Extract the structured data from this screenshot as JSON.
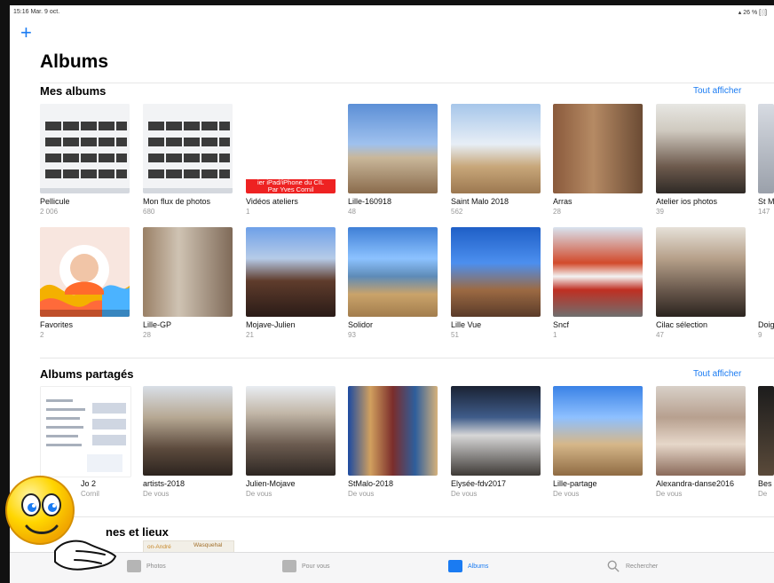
{
  "status_bar": {
    "time": "15:16 Mar. 9 oct.",
    "battery": "▴ 26 % [░]"
  },
  "header": {
    "add_icon": "plus-icon",
    "title": "Albums"
  },
  "sections": {
    "mes_albums": {
      "title": "Mes albums",
      "see_all": "Tout afficher",
      "albums": [
        {
          "name": "Pellicule",
          "count": "2 006"
        },
        {
          "name": "Mon flux de photos",
          "count": "680"
        },
        {
          "name": "Vidéos ateliers",
          "count": "1",
          "overlay_line1": "ier iPad/iPhone du CIL",
          "overlay_line2": "Par Yves Cornil"
        },
        {
          "name": "Lille-160918",
          "count": "48"
        },
        {
          "name": "Saint Malo 2018",
          "count": "562"
        },
        {
          "name": "Arras",
          "count": "28"
        },
        {
          "name": "Atelier ios photos",
          "count": "39"
        },
        {
          "name": "St M",
          "count": "147"
        },
        {
          "name": "Favorites",
          "count": "2"
        },
        {
          "name": "Lille-GP",
          "count": "28"
        },
        {
          "name": "Mojave-Julien",
          "count": "21"
        },
        {
          "name": "Solidor",
          "count": "93"
        },
        {
          "name": "Lille Vue",
          "count": "51"
        },
        {
          "name": "Sncf",
          "count": "1"
        },
        {
          "name": "Cilac sélection",
          "count": "47"
        },
        {
          "name": "Doig",
          "count": "9"
        }
      ]
    },
    "albums_partages": {
      "title": "Albums partagés",
      "see_all": "Tout afficher",
      "albums": [
        {
          "name": "Jo 2",
          "subtitle": "Cornil"
        },
        {
          "name": "artists-2018",
          "subtitle": "De vous"
        },
        {
          "name": "Julien-Mojave",
          "subtitle": "De vous"
        },
        {
          "name": "StMalo-2018",
          "subtitle": "De vous"
        },
        {
          "name": "Elysée-fdv2017",
          "subtitle": "De vous"
        },
        {
          "name": "Lille-partage",
          "subtitle": "De vous"
        },
        {
          "name": "Alexandra-danse2016",
          "subtitle": "De vous"
        },
        {
          "name": "Bes",
          "subtitle": "De"
        }
      ]
    },
    "personnes_lieux": {
      "title": "nes et lieux",
      "place_label": "Wasquehal",
      "place_label_2": "on-André"
    }
  },
  "tabbar": {
    "tabs": [
      {
        "label": "Photos",
        "icon": "photos-icon"
      },
      {
        "label": "Pour vous",
        "icon": "for-you-icon"
      },
      {
        "label": "Albums",
        "icon": "albums-icon"
      },
      {
        "label": "Rechercher",
        "icon": "search-icon"
      }
    ]
  },
  "colors": {
    "accent": "#1a7bf2",
    "overlay_red": "#e22222"
  }
}
